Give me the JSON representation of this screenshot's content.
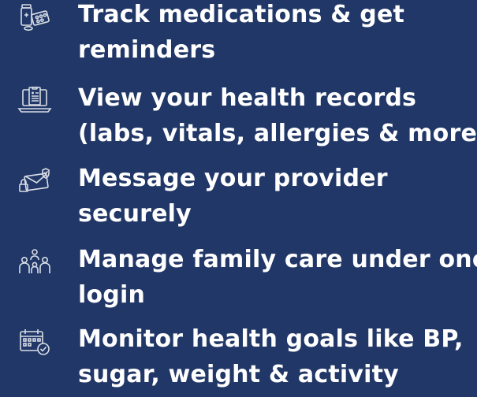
{
  "features": [
    {
      "icon": "medication-icon",
      "line1": "Track medications & get",
      "line2": "reminders"
    },
    {
      "icon": "health-record-icon",
      "line1": "View your health records",
      "line2": "(labs, vitals, allergies & more)"
    },
    {
      "icon": "secure-message-icon",
      "line1": "Message your provider",
      "line2": "securely"
    },
    {
      "icon": "family-icon",
      "line1": "Manage family care under one",
      "line2": "login"
    },
    {
      "icon": "calendar-goals-icon",
      "line1": "Monitor health goals like BP,",
      "line2": "sugar, weight & activity"
    }
  ],
  "colors": {
    "background": "#213767",
    "text": "#ffffff",
    "icon": "#d9dde6"
  }
}
